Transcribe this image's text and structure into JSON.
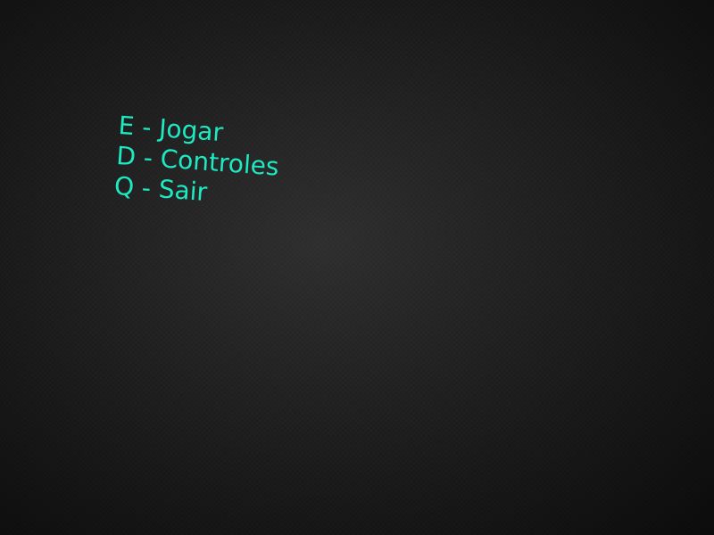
{
  "colors": {
    "menu_text": "#1de9c2",
    "background": "#202020"
  },
  "menu": {
    "options": [
      {
        "key": "E",
        "label": "E - Jogar"
      },
      {
        "key": "D",
        "label": "D - Controles"
      },
      {
        "key": "Q",
        "label": "Q - Sair"
      }
    ]
  }
}
